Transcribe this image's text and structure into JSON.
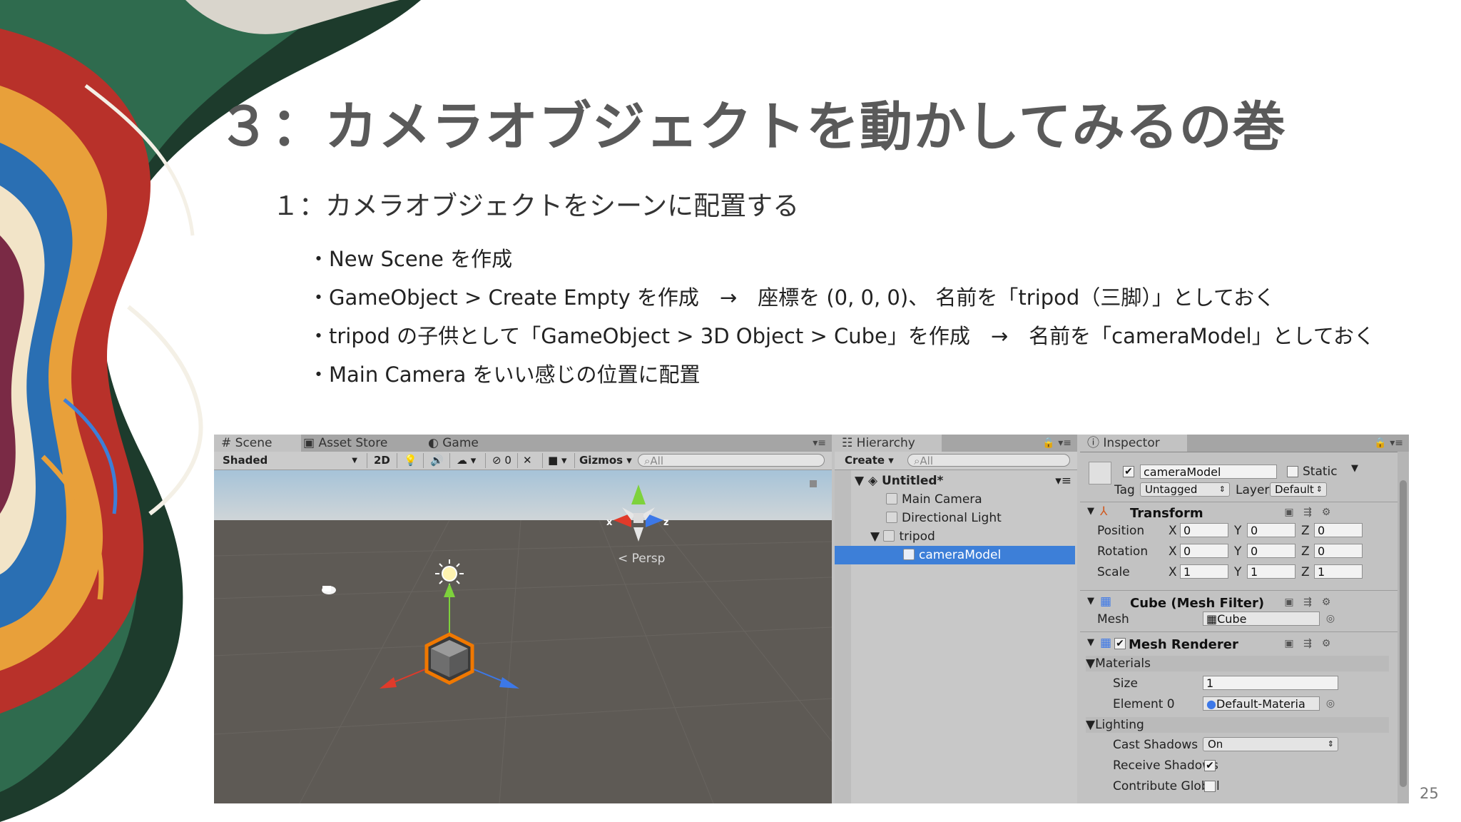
{
  "slide": {
    "title": "３：カメラオブジェクトを動かしてみるの巻",
    "subtitle": "１：カメラオブジェクトをシーンに配置する",
    "bullets": [
      "・New Scene を作成",
      "・GameObject > Create Empty を作成　→　座標を (0, 0, 0)、 名前を「tripod（三脚）」としておく",
      "・tripod の子供として「GameObject > 3D Object > Cube」を作成　→　名前を「cameraModel」としておく",
      "・Main Camera をいい感じの位置に配置"
    ],
    "page_number": "25"
  },
  "scene_panel": {
    "tabs": [
      "Scene",
      "Asset Store",
      "Game"
    ],
    "toolbar": {
      "shading": "Shaded",
      "mode_2d": "2D",
      "hidden_count": "0",
      "gizmos": "Gizmos",
      "search_placeholder": "All"
    },
    "gizmo": {
      "x_label": "x",
      "z_label": "z",
      "projection": "Persp"
    }
  },
  "hierarchy": {
    "tab": "Hierarchy",
    "create": "Create",
    "search_placeholder": "All",
    "scene_name": "Untitled*",
    "items": [
      "Main Camera",
      "Directional Light",
      "tripod",
      "cameraModel"
    ]
  },
  "inspector": {
    "tab": "Inspector",
    "object_name": "cameraModel",
    "static_label": "Static",
    "tag_label": "Tag",
    "tag_value": "Untagged",
    "layer_label": "Layer",
    "layer_value": "Default",
    "transform": {
      "title": "Transform",
      "position_label": "Position",
      "rotation_label": "Rotation",
      "scale_label": "Scale",
      "axis_x": "X",
      "axis_y": "Y",
      "axis_z": "Z",
      "position": [
        "0",
        "0",
        "0"
      ],
      "rotation": [
        "0",
        "0",
        "0"
      ],
      "scale": [
        "1",
        "1",
        "1"
      ]
    },
    "mesh_filter": {
      "title": "Cube (Mesh Filter)",
      "mesh_label": "Mesh",
      "mesh_value": "Cube"
    },
    "mesh_renderer": {
      "title": "Mesh Renderer",
      "materials_label": "Materials",
      "size_label": "Size",
      "size_value": "1",
      "element0_label": "Element 0",
      "element0_value": "Default-Materia",
      "lighting_label": "Lighting",
      "cast_shadows_label": "Cast Shadows",
      "cast_shadows_value": "On",
      "receive_shadows_label": "Receive Shadows",
      "contribute_global_label": "Contribute Global"
    }
  },
  "colors": {
    "title_gray": "#5a5a5a",
    "selection_blue": "#3d7fd8",
    "axis_red": "#e03a2a",
    "axis_green": "#7ed23c",
    "axis_blue": "#3c78e8",
    "selection_outline": "#f07800"
  }
}
